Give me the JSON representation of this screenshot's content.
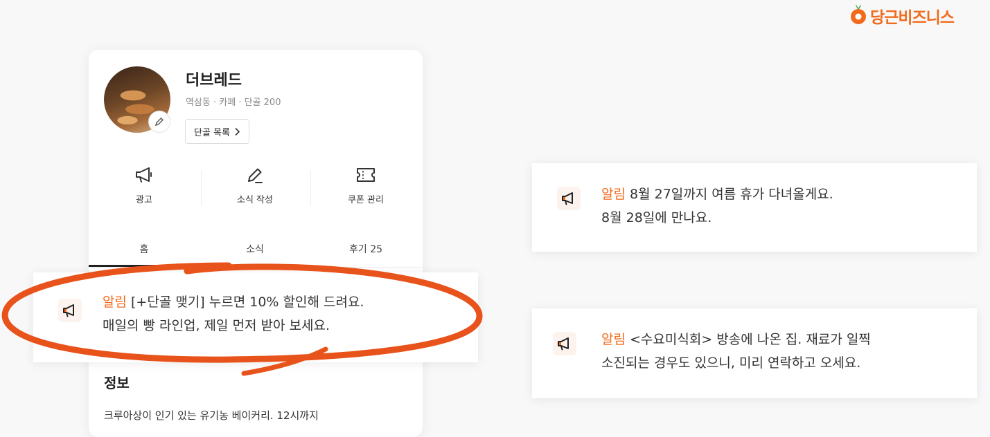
{
  "brand": {
    "name": "당근비즈니스",
    "color": "#f26a1b"
  },
  "profile": {
    "name": "더브레드",
    "meta": "역삼동 · 카페 · 단골 200",
    "regulars_button": "단골 목록",
    "avatar_icon": "bread-photo",
    "edit_icon": "pencil-icon"
  },
  "actions": [
    {
      "label": "광고",
      "icon": "megaphone-icon"
    },
    {
      "label": "소식 작성",
      "icon": "pencil-icon"
    },
    {
      "label": "쿠폰 관리",
      "icon": "ticket-icon"
    }
  ],
  "tabs": [
    {
      "label": "홈",
      "active": true
    },
    {
      "label": "소식",
      "active": false
    },
    {
      "label": "후기 25",
      "active": false
    }
  ],
  "notices": {
    "highlighted": {
      "tag": "알림",
      "line1": "[+단골 맺기] 누르면 10% 할인해 드려요.",
      "line2": "매일의 빵 라인업, 제일 먼저 받아 보세요."
    },
    "right_top": {
      "tag": "알림",
      "line1": "8월 27일까지 여름 휴가 다녀올게요.",
      "line2": "8월 28일에 만나요."
    },
    "right_bottom": {
      "tag": "알림",
      "line1": "<수요미식회> 방송에 나온 집. 재료가 일찍",
      "line2": "소진되는 경우도 있으니, 미리 연락하고 오세요."
    }
  },
  "info": {
    "title": "정보",
    "text": "크루아상이 인기 있는 유기농 베이커리. 12시까지"
  },
  "colors": {
    "accent": "#f26a1b",
    "annotation": "#e8531c",
    "notice_icon_bg": "#fdf3ee"
  }
}
